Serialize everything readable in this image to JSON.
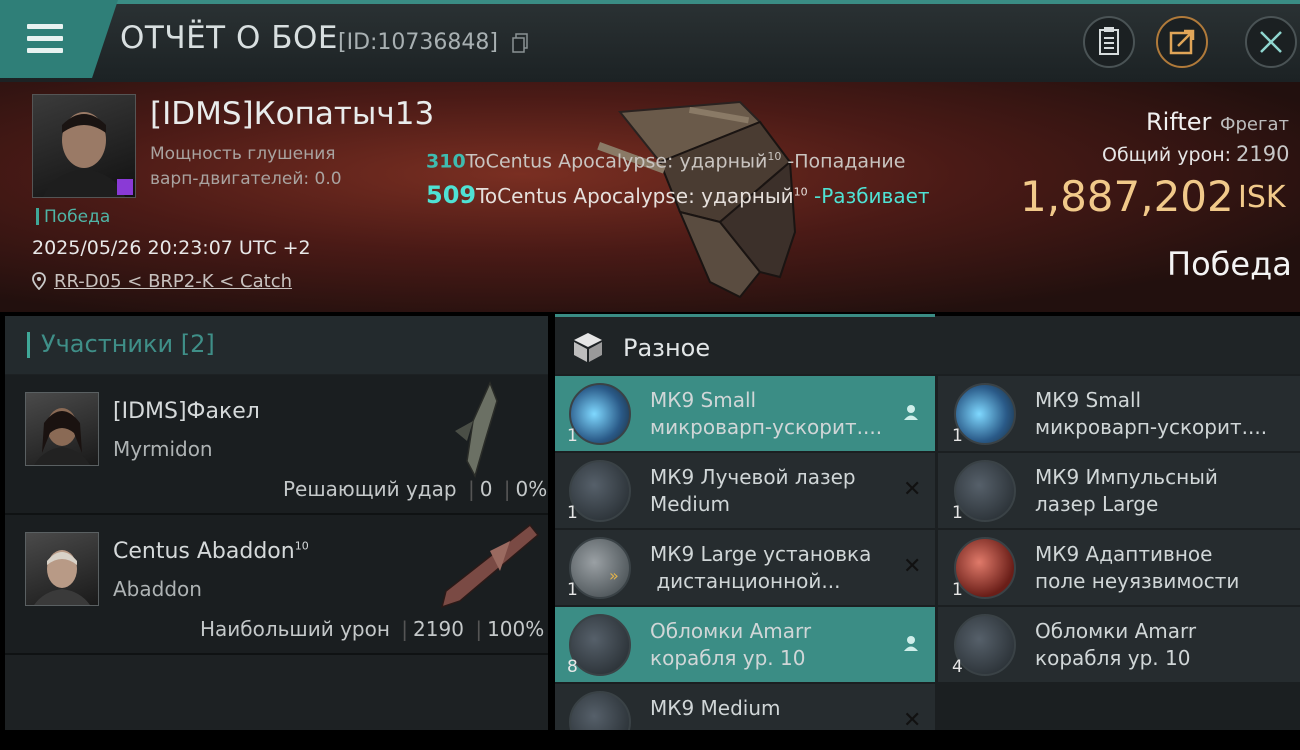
{
  "header": {
    "title": "ОТЧЁТ О БОЕ",
    "report_id": "[ID:10736848]"
  },
  "victim": {
    "pilot_name": "[IDMS]Копатыч13",
    "warp_label_line1": "Мощность глушения",
    "warp_label_line2": "варп-двигателей: 0.0",
    "badge": "Победа",
    "datetime": "2025/05/26 20:23:07 UTC +2",
    "location": "RR-D05 < BRP2-K < Catch",
    "ship_name": "Rifter",
    "ship_class": "Фрегат",
    "total_damage_label": "Общий урон:",
    "total_damage": "2190",
    "isk_value": "1,887,202",
    "isk_unit": "ISK",
    "result": "Победа"
  },
  "combat_log": [
    {
      "damage": "310",
      "source": "ToCentus Apocalypse: ударный",
      "level": "10",
      "result": "-Попадание"
    },
    {
      "damage": "509",
      "source": "ToCentus Apocalypse: ударный",
      "level": "10",
      "result": "-Разбивает"
    }
  ],
  "participants": {
    "header": "Участники [2]",
    "list": [
      {
        "name": "[IDMS]Факел",
        "level": "",
        "ship": "Myrmidon",
        "stat_label": "Решающий удар",
        "damage": "0",
        "percent": "0%"
      },
      {
        "name": "Centus Abaddon",
        "level": "10",
        "ship": "Abaddon",
        "stat_label": "Наибольший урон",
        "damage": "2190",
        "percent": "100%"
      }
    ]
  },
  "items": {
    "header": "Разное",
    "left": [
      {
        "qty": "1",
        "line1": "МК9 Small",
        "line2": "микроварп-ускорит....",
        "status": "dropped"
      },
      {
        "qty": "1",
        "line1": "МК9 Лучевой лазер",
        "line2": "Medium",
        "status": "destroyed"
      },
      {
        "qty": "1",
        "line1": "МК9 Large установка",
        "line2": " дистанционной...",
        "status": "destroyed"
      },
      {
        "qty": "8",
        "line1": "Обломки Amarr",
        "line2": "корабля ур. 10",
        "status": "dropped"
      },
      {
        "qty": "",
        "line1": "МК9 Medium",
        "line2": "",
        "status": "destroyed"
      }
    ],
    "right": [
      {
        "qty": "1",
        "line1": "МК9 Small",
        "line2": "микроварп-ускорит....",
        "status": ""
      },
      {
        "qty": "1",
        "line1": "МК9 Импульсный",
        "line2": "лазер Large",
        "status": ""
      },
      {
        "qty": "1",
        "line1": "МК9 Адаптивное",
        "line2": "поле неуязвимости",
        "status": ""
      },
      {
        "qty": "4",
        "line1": "Обломки Amarr",
        "line2": "корабля ур. 10",
        "status": ""
      }
    ]
  }
}
